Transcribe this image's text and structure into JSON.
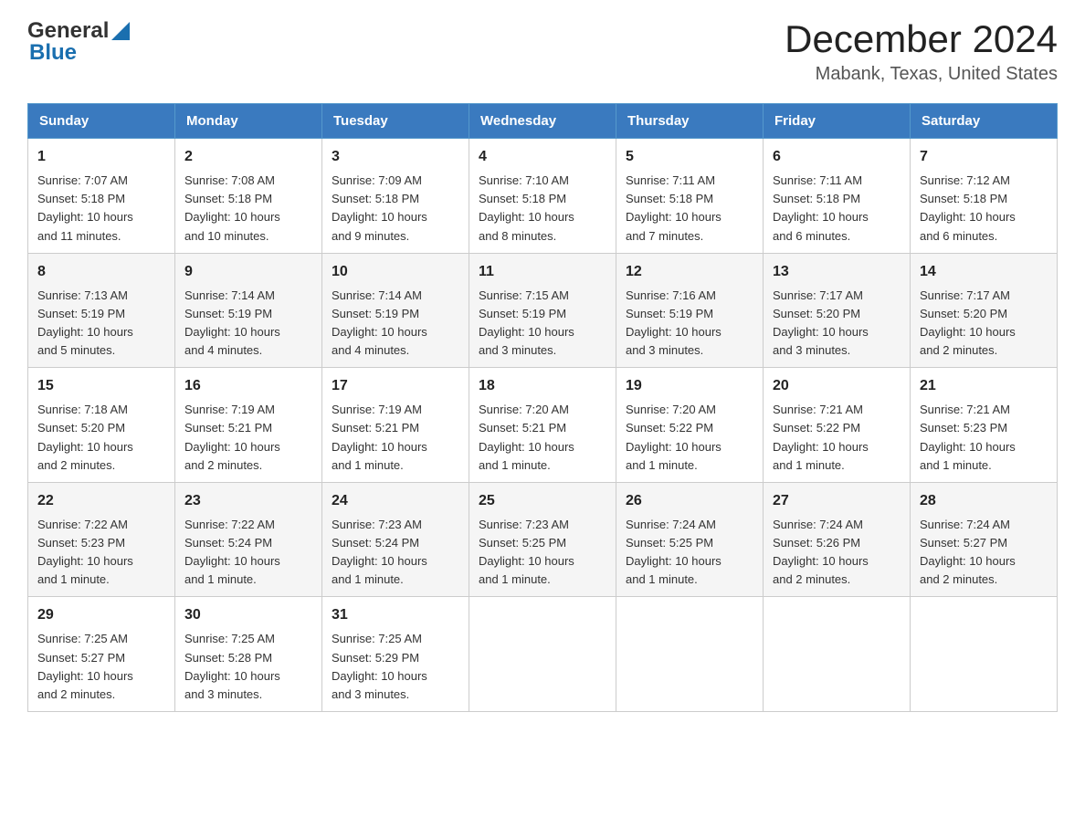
{
  "header": {
    "logo_general": "General",
    "logo_blue": "Blue",
    "month_year": "December 2024",
    "location": "Mabank, Texas, United States"
  },
  "days_of_week": [
    "Sunday",
    "Monday",
    "Tuesday",
    "Wednesday",
    "Thursday",
    "Friday",
    "Saturday"
  ],
  "weeks": [
    [
      {
        "day": "1",
        "sunrise": "7:07 AM",
        "sunset": "5:18 PM",
        "daylight": "10 hours and 11 minutes."
      },
      {
        "day": "2",
        "sunrise": "7:08 AM",
        "sunset": "5:18 PM",
        "daylight": "10 hours and 10 minutes."
      },
      {
        "day": "3",
        "sunrise": "7:09 AM",
        "sunset": "5:18 PM",
        "daylight": "10 hours and 9 minutes."
      },
      {
        "day": "4",
        "sunrise": "7:10 AM",
        "sunset": "5:18 PM",
        "daylight": "10 hours and 8 minutes."
      },
      {
        "day": "5",
        "sunrise": "7:11 AM",
        "sunset": "5:18 PM",
        "daylight": "10 hours and 7 minutes."
      },
      {
        "day": "6",
        "sunrise": "7:11 AM",
        "sunset": "5:18 PM",
        "daylight": "10 hours and 6 minutes."
      },
      {
        "day": "7",
        "sunrise": "7:12 AM",
        "sunset": "5:18 PM",
        "daylight": "10 hours and 6 minutes."
      }
    ],
    [
      {
        "day": "8",
        "sunrise": "7:13 AM",
        "sunset": "5:19 PM",
        "daylight": "10 hours and 5 minutes."
      },
      {
        "day": "9",
        "sunrise": "7:14 AM",
        "sunset": "5:19 PM",
        "daylight": "10 hours and 4 minutes."
      },
      {
        "day": "10",
        "sunrise": "7:14 AM",
        "sunset": "5:19 PM",
        "daylight": "10 hours and 4 minutes."
      },
      {
        "day": "11",
        "sunrise": "7:15 AM",
        "sunset": "5:19 PM",
        "daylight": "10 hours and 3 minutes."
      },
      {
        "day": "12",
        "sunrise": "7:16 AM",
        "sunset": "5:19 PM",
        "daylight": "10 hours and 3 minutes."
      },
      {
        "day": "13",
        "sunrise": "7:17 AM",
        "sunset": "5:20 PM",
        "daylight": "10 hours and 3 minutes."
      },
      {
        "day": "14",
        "sunrise": "7:17 AM",
        "sunset": "5:20 PM",
        "daylight": "10 hours and 2 minutes."
      }
    ],
    [
      {
        "day": "15",
        "sunrise": "7:18 AM",
        "sunset": "5:20 PM",
        "daylight": "10 hours and 2 minutes."
      },
      {
        "day": "16",
        "sunrise": "7:19 AM",
        "sunset": "5:21 PM",
        "daylight": "10 hours and 2 minutes."
      },
      {
        "day": "17",
        "sunrise": "7:19 AM",
        "sunset": "5:21 PM",
        "daylight": "10 hours and 1 minute."
      },
      {
        "day": "18",
        "sunrise": "7:20 AM",
        "sunset": "5:21 PM",
        "daylight": "10 hours and 1 minute."
      },
      {
        "day": "19",
        "sunrise": "7:20 AM",
        "sunset": "5:22 PM",
        "daylight": "10 hours and 1 minute."
      },
      {
        "day": "20",
        "sunrise": "7:21 AM",
        "sunset": "5:22 PM",
        "daylight": "10 hours and 1 minute."
      },
      {
        "day": "21",
        "sunrise": "7:21 AM",
        "sunset": "5:23 PM",
        "daylight": "10 hours and 1 minute."
      }
    ],
    [
      {
        "day": "22",
        "sunrise": "7:22 AM",
        "sunset": "5:23 PM",
        "daylight": "10 hours and 1 minute."
      },
      {
        "day": "23",
        "sunrise": "7:22 AM",
        "sunset": "5:24 PM",
        "daylight": "10 hours and 1 minute."
      },
      {
        "day": "24",
        "sunrise": "7:23 AM",
        "sunset": "5:24 PM",
        "daylight": "10 hours and 1 minute."
      },
      {
        "day": "25",
        "sunrise": "7:23 AM",
        "sunset": "5:25 PM",
        "daylight": "10 hours and 1 minute."
      },
      {
        "day": "26",
        "sunrise": "7:24 AM",
        "sunset": "5:25 PM",
        "daylight": "10 hours and 1 minute."
      },
      {
        "day": "27",
        "sunrise": "7:24 AM",
        "sunset": "5:26 PM",
        "daylight": "10 hours and 2 minutes."
      },
      {
        "day": "28",
        "sunrise": "7:24 AM",
        "sunset": "5:27 PM",
        "daylight": "10 hours and 2 minutes."
      }
    ],
    [
      {
        "day": "29",
        "sunrise": "7:25 AM",
        "sunset": "5:27 PM",
        "daylight": "10 hours and 2 minutes."
      },
      {
        "day": "30",
        "sunrise": "7:25 AM",
        "sunset": "5:28 PM",
        "daylight": "10 hours and 3 minutes."
      },
      {
        "day": "31",
        "sunrise": "7:25 AM",
        "sunset": "5:29 PM",
        "daylight": "10 hours and 3 minutes."
      },
      null,
      null,
      null,
      null
    ]
  ],
  "labels": {
    "sunrise": "Sunrise:",
    "sunset": "Sunset:",
    "daylight": "Daylight:"
  }
}
